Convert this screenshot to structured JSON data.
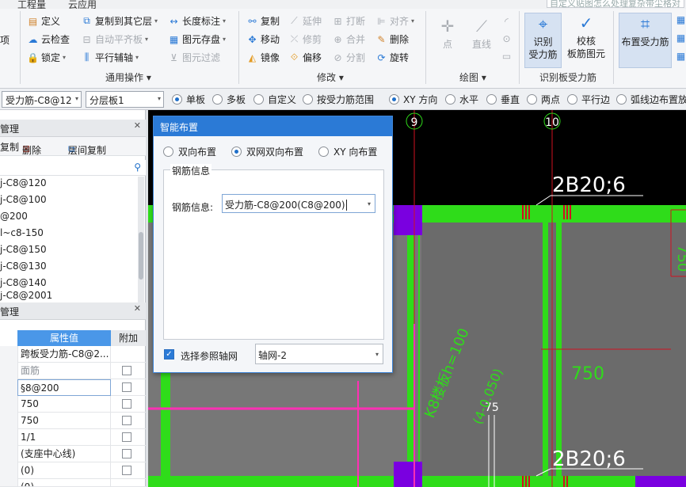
{
  "menubar": {
    "items": [
      "工程量",
      "云应用"
    ],
    "search_placeholder": "自定义贴图怎么处理复杂带尘格对件"
  },
  "ribbon": {
    "left_stub": "项",
    "common": {
      "items": [
        "定义",
        "云检查",
        "锁定",
        "复制到其它层",
        "自动平齐板",
        "平行辅轴",
        "长度标注",
        "图元存盘",
        "图元过滤"
      ],
      "label": "通用操作"
    },
    "modify": {
      "items": [
        "复制",
        "移动",
        "镜像",
        "延伸",
        "修剪",
        "偏移",
        "打断",
        "合并",
        "分割",
        "对齐",
        "删除",
        "旋转"
      ],
      "label": "修改"
    },
    "draw": {
      "items": [
        "点",
        "直线"
      ],
      "label": "绘图"
    },
    "recognize": {
      "items": [
        "识别\n受力筋",
        "校核\n板筋图元"
      ],
      "label": "识别板受力筋"
    },
    "place": {
      "items": [
        "布置受力筋"
      ]
    }
  },
  "proptoolbar": {
    "combo1": "受力筋-C8@12",
    "combo2": "分层板1",
    "radios": [
      "单板",
      "多板",
      "自定义",
      "按受力筋范围",
      "XY 方向",
      "水平",
      "垂直",
      "两点",
      "平行边",
      "弧线边布置放"
    ],
    "selected": [
      "单板",
      "XY 方向"
    ]
  },
  "leftpanel": {
    "title1": "管理",
    "toolbar": [
      "复制",
      "删除",
      "层间复制"
    ],
    "list": [
      "j-C8@120",
      "j-C8@100",
      "@200",
      "l~c8-150",
      "j-C8@150",
      "j-C8@130",
      "j-C8@140",
      "j-C8@2001"
    ],
    "title2": "管理",
    "table_headers": [
      "属性值",
      "附加"
    ],
    "table_rows": [
      "跨板受力筋-C8@2...",
      "面筋",
      "§8@200",
      "750",
      "750",
      "1/1",
      "(支座中心线)",
      "(0)",
      "(0)"
    ]
  },
  "canvas": {
    "axis_labels": [
      "9",
      "10"
    ],
    "annotations": [
      "2B20;6",
      "2B20;6",
      "750",
      "75",
      "750",
      "K8楼板h=100",
      "(4-0.050)"
    ]
  },
  "dialog": {
    "title": "智能布置",
    "options": [
      "双向布置",
      "双网双向布置",
      "XY 向布置"
    ],
    "selected_option": "双网双向布置",
    "group_title": "钢筋信息",
    "field_label": "钢筋信息:",
    "field_value": "受力筋-C8@200(C8@200)",
    "checkbox_label": "选择参照轴网",
    "axis_select": "轴网-2"
  },
  "colors": {
    "accent": "#2b7ad6",
    "beam_green": "#2fdc1a",
    "rebar_magenta": "#ff2fb4",
    "column_purple": "#7a00e0",
    "slab_gray": "#777777"
  }
}
